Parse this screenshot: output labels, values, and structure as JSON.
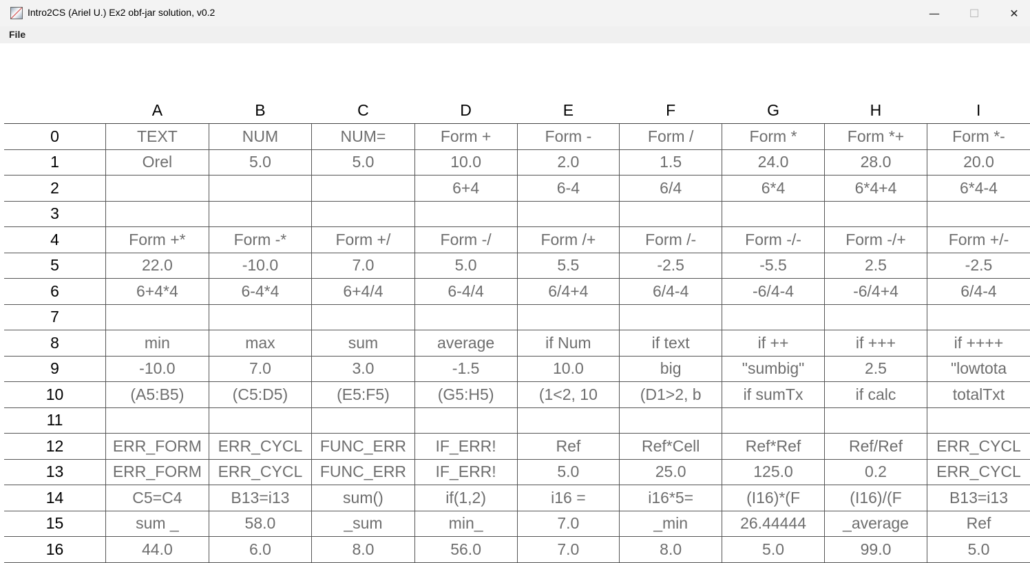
{
  "window": {
    "title": "Intro2CS (Ariel U.) Ex2 obf-jar solution, v0.2",
    "minimize": "—",
    "maximize": "☐",
    "close": "✕"
  },
  "menu": {
    "file": "File"
  },
  "colors": {
    "gray": "#6e6e6e",
    "black": "#000000",
    "blue": "#0000ff",
    "magenta": "#ff00ff",
    "orange": "#ffb800",
    "red": "#ff0000",
    "darkred": "#b00000"
  },
  "sheet": {
    "columns": [
      "A",
      "B",
      "C",
      "D",
      "E",
      "F",
      "G",
      "H",
      "I"
    ],
    "rows": [
      {
        "label": "0",
        "cells": [
          {
            "text": "TEXT",
            "color": "gray"
          },
          {
            "text": "NUM",
            "color": "gray"
          },
          {
            "text": "NUM=",
            "color": "gray"
          },
          {
            "text": "Form +",
            "color": "gray"
          },
          {
            "text": "Form -",
            "color": "gray"
          },
          {
            "text": "Form /",
            "color": "gray"
          },
          {
            "text": "Form *",
            "color": "gray"
          },
          {
            "text": "Form *+",
            "color": "gray"
          },
          {
            "text": "Form *-",
            "color": "gray"
          }
        ]
      },
      {
        "label": "1",
        "cells": [
          {
            "text": "Orel",
            "color": "gray"
          },
          {
            "text": "5.0",
            "color": "black"
          },
          {
            "text": "5.0",
            "color": "blue"
          },
          {
            "text": "10.0",
            "color": "blue"
          },
          {
            "text": "2.0",
            "color": "blue"
          },
          {
            "text": "1.5",
            "color": "blue"
          },
          {
            "text": "24.0",
            "color": "blue"
          },
          {
            "text": "28.0",
            "color": "blue"
          },
          {
            "text": "20.0",
            "color": "blue"
          }
        ]
      },
      {
        "label": "2",
        "cells": [
          {
            "text": "",
            "color": "gray"
          },
          {
            "text": "",
            "color": "gray"
          },
          {
            "text": "",
            "color": "gray"
          },
          {
            "text": "6+4",
            "color": "gray"
          },
          {
            "text": "6-4",
            "color": "gray"
          },
          {
            "text": "6/4",
            "color": "gray"
          },
          {
            "text": "6*4",
            "color": "gray"
          },
          {
            "text": "6*4+4",
            "color": "gray"
          },
          {
            "text": "6*4-4",
            "color": "gray"
          }
        ]
      },
      {
        "label": "3",
        "cells": [
          {
            "text": "",
            "color": "gray"
          },
          {
            "text": "",
            "color": "gray"
          },
          {
            "text": "",
            "color": "gray"
          },
          {
            "text": "",
            "color": "gray"
          },
          {
            "text": "",
            "color": "gray"
          },
          {
            "text": "",
            "color": "gray"
          },
          {
            "text": "",
            "color": "gray"
          },
          {
            "text": "",
            "color": "gray"
          },
          {
            "text": "",
            "color": "gray"
          }
        ]
      },
      {
        "label": "4",
        "cells": [
          {
            "text": "Form +*",
            "color": "gray"
          },
          {
            "text": "Form -*",
            "color": "gray"
          },
          {
            "text": "Form +/",
            "color": "gray"
          },
          {
            "text": "Form -/",
            "color": "gray"
          },
          {
            "text": "Form /+",
            "color": "gray"
          },
          {
            "text": "Form /-",
            "color": "gray"
          },
          {
            "text": "Form -/-",
            "color": "gray"
          },
          {
            "text": "Form -/+",
            "color": "gray"
          },
          {
            "text": "Form +/-",
            "color": "gray"
          }
        ]
      },
      {
        "label": "5",
        "cells": [
          {
            "text": "22.0",
            "color": "blue"
          },
          {
            "text": "-10.0",
            "color": "blue"
          },
          {
            "text": "7.0",
            "color": "blue"
          },
          {
            "text": "5.0",
            "color": "blue"
          },
          {
            "text": "5.5",
            "color": "blue"
          },
          {
            "text": "-2.5",
            "color": "blue"
          },
          {
            "text": "-5.5",
            "color": "blue"
          },
          {
            "text": "2.5",
            "color": "blue"
          },
          {
            "text": "-2.5",
            "color": "blue"
          }
        ]
      },
      {
        "label": "6",
        "cells": [
          {
            "text": "6+4*4",
            "color": "gray"
          },
          {
            "text": "6-4*4",
            "color": "gray"
          },
          {
            "text": "6+4/4",
            "color": "gray"
          },
          {
            "text": "6-4/4",
            "color": "gray"
          },
          {
            "text": "6/4+4",
            "color": "gray"
          },
          {
            "text": "6/4-4",
            "color": "gray"
          },
          {
            "text": "-6/4-4",
            "color": "gray"
          },
          {
            "text": "-6/4+4",
            "color": "gray"
          },
          {
            "text": "6/4-4",
            "color": "gray"
          }
        ]
      },
      {
        "label": "7",
        "cells": [
          {
            "text": "",
            "color": "gray"
          },
          {
            "text": "",
            "color": "gray"
          },
          {
            "text": "",
            "color": "gray"
          },
          {
            "text": "",
            "color": "gray"
          },
          {
            "text": "",
            "color": "gray"
          },
          {
            "text": "",
            "color": "gray"
          },
          {
            "text": "",
            "color": "gray"
          },
          {
            "text": "",
            "color": "gray"
          },
          {
            "text": "",
            "color": "gray"
          }
        ]
      },
      {
        "label": "8",
        "cells": [
          {
            "text": "min",
            "color": "gray"
          },
          {
            "text": "max",
            "color": "gray"
          },
          {
            "text": "sum",
            "color": "gray"
          },
          {
            "text": "average",
            "color": "gray"
          },
          {
            "text": "if Num",
            "color": "gray"
          },
          {
            "text": "if text",
            "color": "gray"
          },
          {
            "text": "if ++",
            "color": "gray"
          },
          {
            "text": "if +++",
            "color": "gray"
          },
          {
            "text": "if ++++",
            "color": "gray"
          }
        ]
      },
      {
        "label": "9",
        "cells": [
          {
            "text": "-10.0",
            "color": "magenta"
          },
          {
            "text": "7.0",
            "color": "magenta"
          },
          {
            "text": "3.0",
            "color": "magenta"
          },
          {
            "text": "-1.5",
            "color": "magenta"
          },
          {
            "text": "10.0",
            "color": "orange"
          },
          {
            "text": "big",
            "color": "orange"
          },
          {
            "text": "\"sumbig\"",
            "color": "orange"
          },
          {
            "text": "2.5",
            "color": "orange"
          },
          {
            "text": "\"lowtota",
            "color": "orange"
          }
        ]
      },
      {
        "label": "10",
        "cells": [
          {
            "text": "(A5:B5)",
            "color": "gray"
          },
          {
            "text": "(C5:D5)",
            "color": "gray"
          },
          {
            "text": "(E5:F5)",
            "color": "gray"
          },
          {
            "text": "(G5:H5)",
            "color": "gray"
          },
          {
            "text": "(1<2, 10",
            "color": "gray"
          },
          {
            "text": "(D1>2, b",
            "color": "gray"
          },
          {
            "text": "if sumTx",
            "color": "gray"
          },
          {
            "text": "if calc",
            "color": "gray"
          },
          {
            "text": "totalTxt",
            "color": "gray"
          }
        ]
      },
      {
        "label": "11",
        "cells": [
          {
            "text": "",
            "color": "gray"
          },
          {
            "text": "",
            "color": "gray"
          },
          {
            "text": "",
            "color": "gray"
          },
          {
            "text": "",
            "color": "gray"
          },
          {
            "text": "",
            "color": "gray"
          },
          {
            "text": "",
            "color": "gray"
          },
          {
            "text": "",
            "color": "gray"
          },
          {
            "text": "",
            "color": "gray"
          },
          {
            "text": "",
            "color": "gray"
          }
        ]
      },
      {
        "label": "12",
        "cells": [
          {
            "text": "ERR_FORM",
            "color": "gray"
          },
          {
            "text": "ERR_CYCL",
            "color": "gray"
          },
          {
            "text": "FUNC_ERR",
            "color": "gray"
          },
          {
            "text": "IF_ERR!",
            "color": "gray"
          },
          {
            "text": "Ref",
            "color": "gray"
          },
          {
            "text": "Ref*Cell",
            "color": "gray"
          },
          {
            "text": "Ref*Ref",
            "color": "gray"
          },
          {
            "text": "Ref/Ref",
            "color": "gray"
          },
          {
            "text": "ERR_CYCL",
            "color": "gray"
          }
        ]
      },
      {
        "label": "13",
        "cells": [
          {
            "text": "ERR_FORM",
            "color": "red"
          },
          {
            "text": "ERR_CYCL",
            "color": "darkred"
          },
          {
            "text": "FUNC_ERR",
            "color": "red"
          },
          {
            "text": "IF_ERR!",
            "color": "red"
          },
          {
            "text": "5.0",
            "color": "blue"
          },
          {
            "text": "25.0",
            "color": "blue"
          },
          {
            "text": "125.0",
            "color": "blue"
          },
          {
            "text": "0.2",
            "color": "blue"
          },
          {
            "text": "ERR_CYCL",
            "color": "darkred"
          }
        ]
      },
      {
        "label": "14",
        "cells": [
          {
            "text": "C5=C4",
            "color": "gray"
          },
          {
            "text": "B13=i13",
            "color": "gray"
          },
          {
            "text": "sum()",
            "color": "gray"
          },
          {
            "text": "if(1,2)",
            "color": "gray"
          },
          {
            "text": "i16 =",
            "color": "gray"
          },
          {
            "text": "i16*5=",
            "color": "gray"
          },
          {
            "text": "(I16)*(F",
            "color": "gray"
          },
          {
            "text": "(I16)/(F",
            "color": "gray"
          },
          {
            "text": "B13=i13",
            "color": "gray"
          }
        ]
      },
      {
        "label": "15",
        "cells": [
          {
            "text": "sum _",
            "color": "gray"
          },
          {
            "text": "58.0",
            "color": "magenta"
          },
          {
            "text": "_sum",
            "color": "gray"
          },
          {
            "text": "min_",
            "color": "gray"
          },
          {
            "text": "7.0",
            "color": "magenta"
          },
          {
            "text": "_min",
            "color": "gray"
          },
          {
            "text": "26.44444",
            "color": "magenta"
          },
          {
            "text": "_average",
            "color": "gray"
          },
          {
            "text": "Ref",
            "color": "gray"
          }
        ]
      },
      {
        "label": "16",
        "cells": [
          {
            "text": "44.0",
            "color": "black"
          },
          {
            "text": "6.0",
            "color": "black"
          },
          {
            "text": "8.0",
            "color": "black"
          },
          {
            "text": "56.0",
            "color": "blue"
          },
          {
            "text": "7.0",
            "color": "blue"
          },
          {
            "text": "8.0",
            "color": "blue"
          },
          {
            "text": "5.0",
            "color": "black"
          },
          {
            "text": "99.0",
            "color": "black"
          },
          {
            "text": "5.0",
            "color": "black"
          }
        ]
      }
    ]
  }
}
